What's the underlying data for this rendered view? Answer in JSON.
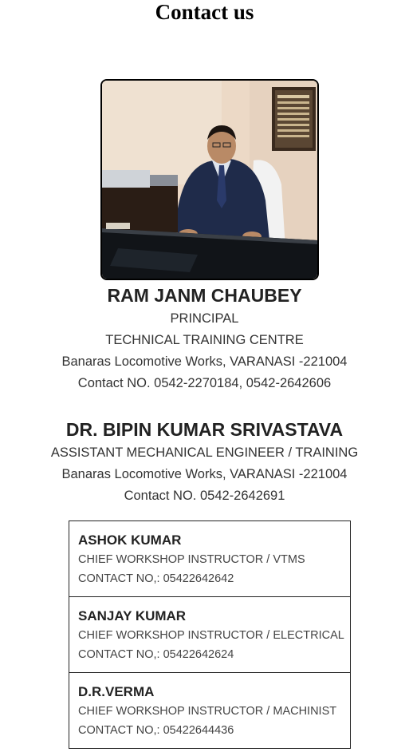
{
  "page": {
    "title": "Contact us"
  },
  "principal": {
    "name": "RAM JANM CHAUBEY",
    "designation": "PRINCIPAL",
    "institute": "TECHNICAL TRAINING CENTRE",
    "address": "Banaras Locomotive Works, VARANASI -221004",
    "contact": "Contact NO. 0542-2270184, 0542-2642606"
  },
  "assistant_engineer": {
    "name": "DR. BIPIN KUMAR SRIVASTAVA",
    "designation": "ASSISTANT MECHANICAL ENGINEER / TRAINING",
    "address": "Banaras Locomotive Works, VARANASI -221004",
    "contact": "Contact NO. 0542-2642691"
  },
  "staff": [
    {
      "name": "ASHOK KUMAR",
      "designation": "CHIEF WORKSHOP INSTRUCTOR / VTMS",
      "contact": "CONTACT NO,: 05422642642"
    },
    {
      "name": "SANJAY KUMAR",
      "designation": "CHIEF WORKSHOP INSTRUCTOR / ELECTRICAL",
      "contact": "CONTACT NO,: 05422642624"
    },
    {
      "name": "D.R.VERMA",
      "designation": "CHIEF WORKSHOP INSTRUCTOR / MACHINIST",
      "contact": "CONTACT NO,: 05422644436"
    }
  ]
}
